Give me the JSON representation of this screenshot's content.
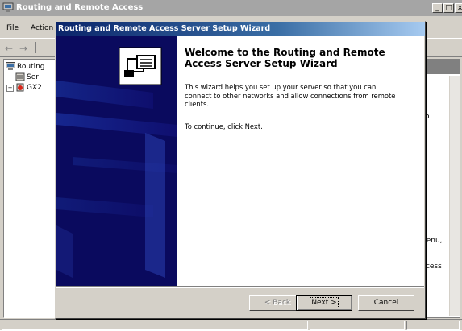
{
  "mmc": {
    "title": "Routing and Remote Access",
    "menu": [
      "File",
      "Action"
    ],
    "tree": {
      "root_label": "Routing",
      "child1_label": "Ser",
      "child2_label": "GX2"
    },
    "right_fragments": [
      "o",
      "nenu,",
      "ccess"
    ]
  },
  "wizard": {
    "title": "Routing and Remote Access Server Setup Wizard",
    "heading": "Welcome to the Routing and Remote Access Server Setup Wizard",
    "body": "This wizard helps you set up your server so that you can connect to other networks and allow connections from remote clients.",
    "instruction": "To continue, click Next.",
    "buttons": {
      "back": "< Back",
      "next": "Next >",
      "cancel": "Cancel"
    }
  },
  "colors": {
    "wizard_title_start": "#0a246a",
    "banner_bg": "#0a0a5e",
    "dialog_face": "#d4d0c8"
  }
}
